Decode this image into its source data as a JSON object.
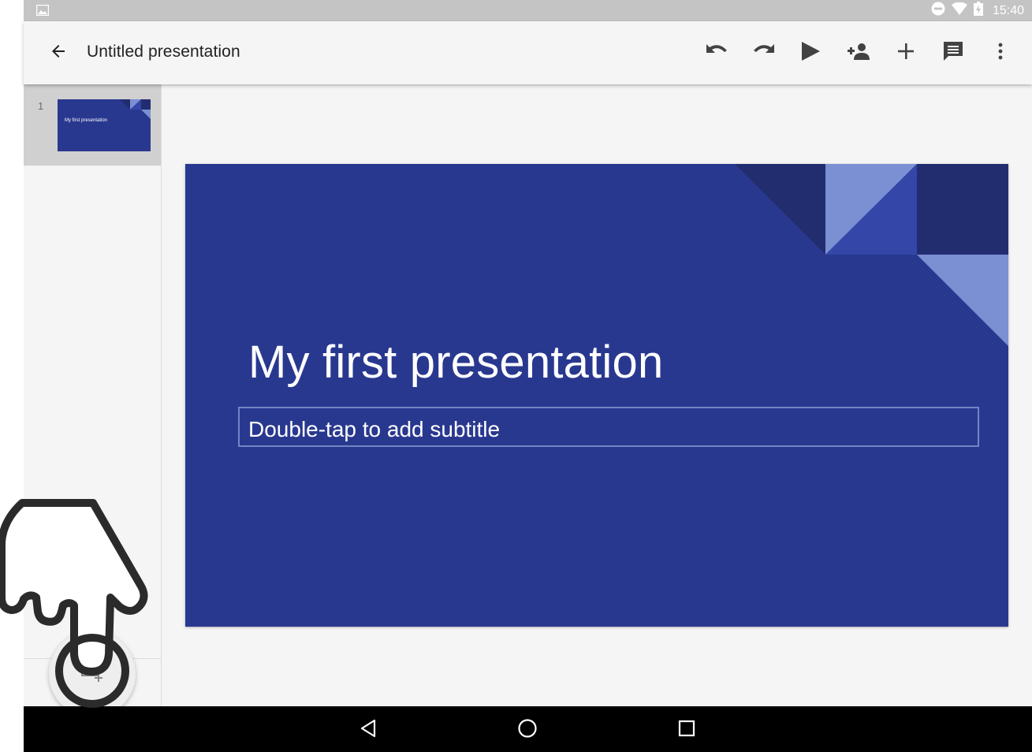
{
  "status_bar": {
    "time": "15:40",
    "icons": [
      "gallery-icon",
      "do-not-disturb-icon",
      "wifi-icon",
      "battery-charging-icon"
    ]
  },
  "app_bar": {
    "back_icon": "arrow-back-icon",
    "title": "Untitled presentation",
    "actions": [
      "undo-icon",
      "redo-icon",
      "present-play-icon",
      "share-add-person-icon",
      "insert-plus-icon",
      "comments-icon",
      "more-vert-icon"
    ]
  },
  "sidebar": {
    "slides": [
      {
        "number": "1",
        "title": "My first presentation"
      }
    ],
    "add_slide_icon": "add-slide-icon"
  },
  "slide": {
    "title": "My first presentation",
    "subtitle_placeholder": "Double-tap to add subtitle",
    "background_color": "#29388f",
    "accent_colors": [
      "#222d70",
      "#7b8fd3",
      "#3446a8"
    ]
  },
  "nav_bar": {
    "buttons": [
      "back-triangle-icon",
      "home-circle-icon",
      "recents-square-icon"
    ]
  },
  "overlay": {
    "pointer": "pointing-hand-icon"
  }
}
